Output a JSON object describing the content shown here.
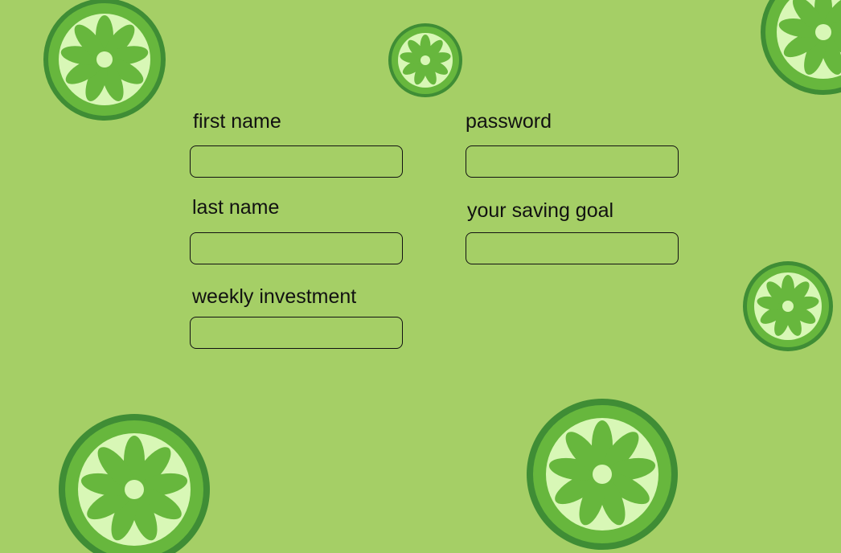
{
  "page": {
    "background": "#a5cf66"
  },
  "theme": {
    "lime_rind": "#3f8d35",
    "lime_flesh": "#67b73d",
    "lime_pith": "#d8f7b6",
    "text": "#111111",
    "input_border": "#111111"
  },
  "form": {
    "fields": [
      {
        "label": "first name",
        "value": "",
        "placeholder": ""
      },
      {
        "label": "last name",
        "value": "",
        "placeholder": ""
      },
      {
        "label": "weekly investment",
        "value": "",
        "placeholder": ""
      },
      {
        "label": "password",
        "value": "",
        "placeholder": ""
      },
      {
        "label": "your saving goal",
        "value": "",
        "placeholder": ""
      }
    ]
  },
  "decorations": {
    "icon": "lime-slice-icon",
    "count": 7
  }
}
